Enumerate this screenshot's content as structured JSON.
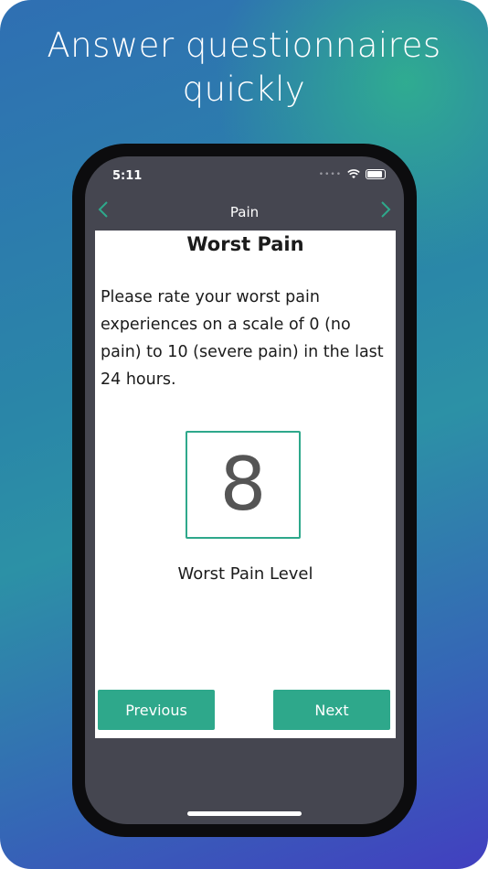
{
  "promo": {
    "headline": "Answer questionnaires quickly"
  },
  "status_bar": {
    "time": "5:11",
    "signal_icon": "signal-dots-icon",
    "wifi_icon": "wifi-icon",
    "battery_icon": "battery-icon"
  },
  "navbar": {
    "title": "Pain",
    "back_icon": "chevron-left-icon",
    "forward_icon": "chevron-right-icon"
  },
  "question": {
    "title": "Worst Pain",
    "text": "Please rate your worst pain experiences on a scale of 0 (no pain) to 10 (severe pain) in the last 24 hours.",
    "value": "8",
    "value_label": "Worst Pain Level"
  },
  "buttons": {
    "previous": "Previous",
    "next": "Next"
  },
  "colors": {
    "accent": "#2ea88b",
    "screen_bg": "#454650"
  }
}
